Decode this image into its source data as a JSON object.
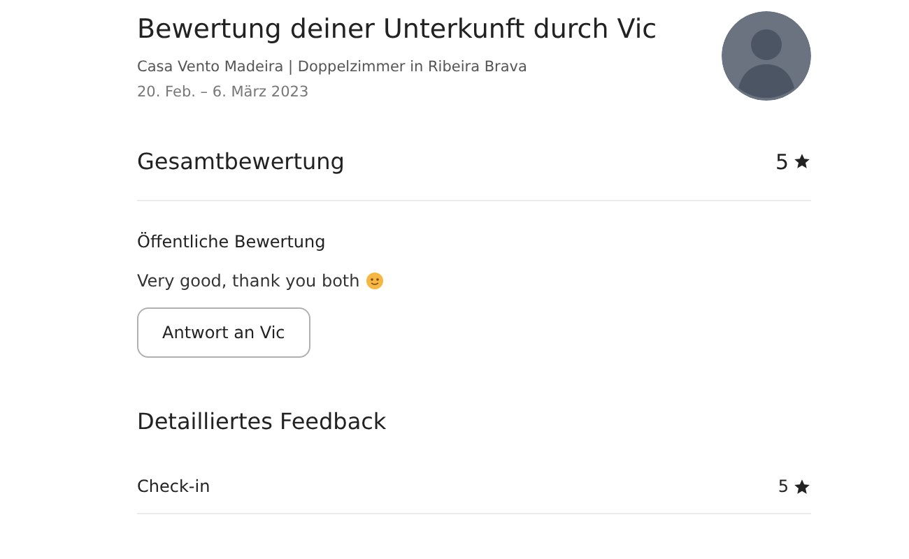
{
  "header": {
    "title": "Bewertung deiner Unterkunft durch Vic",
    "listing": "Casa Vento Madeira | Doppelzimmer in Ribeira Brava",
    "dates": "20. Feb. – 6. März 2023"
  },
  "overall": {
    "label": "Gesamtbewertung",
    "rating": "5"
  },
  "public_review": {
    "label": "Öffentliche Bewertung",
    "text": "Very good, thank you both",
    "reply_button": "Antwort an Vic"
  },
  "detailed": {
    "title": "Detailliertes Feedback",
    "items": [
      {
        "label": "Check-in",
        "rating": "5"
      }
    ]
  }
}
